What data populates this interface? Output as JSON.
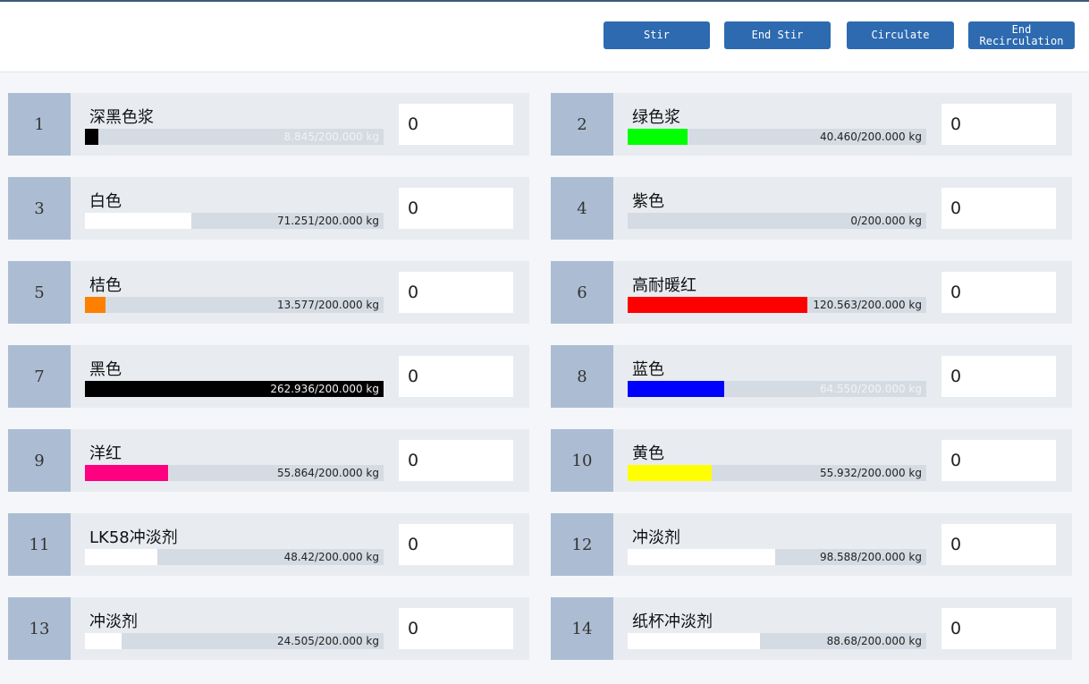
{
  "toolbar": {
    "stir_label": "Stir",
    "end_stir_label": "End Stir",
    "circulate_label": "Circulate",
    "end_recirc_label": "End\nRecirculation"
  },
  "tanks": [
    {
      "number": "1",
      "name": "深黑色浆",
      "reading": "8.845/200.000 kg",
      "fraction": 0.044,
      "color": "#000000",
      "input_value": "0"
    },
    {
      "number": "2",
      "name": "绿色浆",
      "reading": "40.460/200.000 kg",
      "fraction": 0.202,
      "color": "#00ff00",
      "input_value": "0"
    },
    {
      "number": "3",
      "name": "白色",
      "reading": "71.251/200.000 kg",
      "fraction": 0.356,
      "color": "#ffffff",
      "input_value": "0"
    },
    {
      "number": "4",
      "name": "紫色",
      "reading": "0/200.000 kg",
      "fraction": 0,
      "color": "#800080",
      "input_value": "0"
    },
    {
      "number": "5",
      "name": "桔色",
      "reading": "13.577/200.000 kg",
      "fraction": 0.068,
      "color": "#ff8000",
      "input_value": "0"
    },
    {
      "number": "6",
      "name": "高耐暖红",
      "reading": "120.563/200.000 kg",
      "fraction": 0.603,
      "color": "#ff0000",
      "input_value": "0"
    },
    {
      "number": "7",
      "name": "黑色",
      "reading": "262.936/200.000 kg",
      "fraction": 1,
      "color": "#000000",
      "input_value": "0"
    },
    {
      "number": "8",
      "name": "蓝色",
      "reading": "64.550/200.000 kg",
      "fraction": 0.323,
      "color": "#0000ff",
      "input_value": "0"
    },
    {
      "number": "9",
      "name": "洋红",
      "reading": "55.864/200.000 kg",
      "fraction": 0.279,
      "color": "#ff0080",
      "input_value": "0"
    },
    {
      "number": "10",
      "name": "黄色",
      "reading": "55.932/200.000 kg",
      "fraction": 0.28,
      "color": "#ffff00",
      "input_value": "0"
    },
    {
      "number": "11",
      "name": "LK58冲淡剂",
      "reading": "48.42/200.000 kg",
      "fraction": 0.242,
      "color": "#ffffff",
      "input_value": "0"
    },
    {
      "number": "12",
      "name": "冲淡剂",
      "reading": "98.588/200.000 kg",
      "fraction": 0.493,
      "color": "#ffffff",
      "input_value": "0"
    },
    {
      "number": "13",
      "name": "冲淡剂",
      "reading": "24.505/200.000 kg",
      "fraction": 0.123,
      "color": "#ffffff",
      "input_value": "0"
    },
    {
      "number": "14",
      "name": "纸杯冲淡剂",
      "reading": "88.68/200.000 kg",
      "fraction": 0.443,
      "color": "#ffffff",
      "input_value": "0"
    }
  ]
}
